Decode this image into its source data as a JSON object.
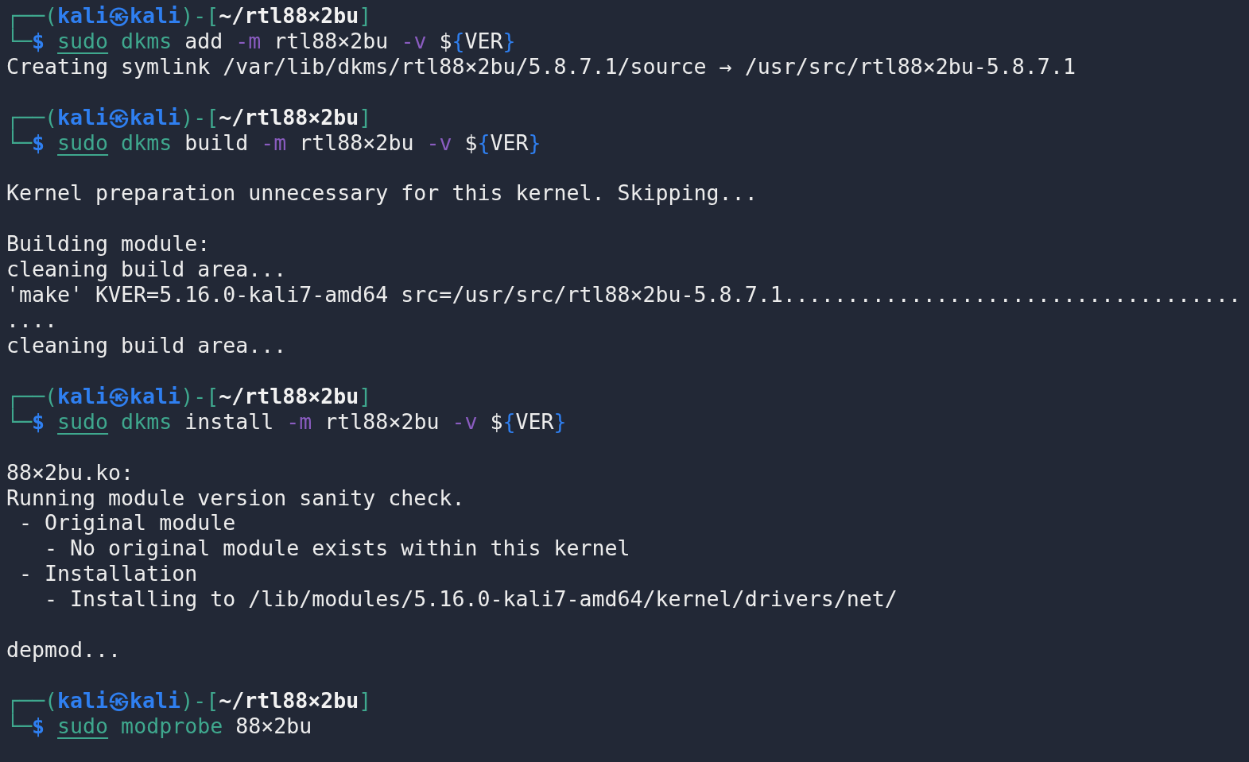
{
  "terminal": {
    "lines": [
      {
        "kind": "text",
        "segments": [
          {
            "kind": "frame",
            "text": "┌──("
          },
          {
            "kind": "user",
            "text": "kali㉿kali"
          },
          {
            "kind": "frame",
            "text": ")-["
          },
          {
            "kind": "path",
            "text": "~/rtl88×2bu"
          },
          {
            "kind": "frame",
            "text": "]"
          }
        ]
      },
      {
        "kind": "text",
        "segments": [
          {
            "kind": "frame",
            "text": "└─"
          },
          {
            "kind": "prompt",
            "text": "$ "
          },
          {
            "kind": "sudo",
            "text": "sudo"
          },
          {
            "kind": "cmd",
            "text": " dkms"
          },
          {
            "kind": "plain",
            "text": " add"
          },
          {
            "kind": "flag",
            "text": " -m"
          },
          {
            "kind": "plain",
            "text": " rtl88×2bu"
          },
          {
            "kind": "flag",
            "text": " -v"
          },
          {
            "kind": "plain",
            "text": " $"
          },
          {
            "kind": "brace",
            "text": "{"
          },
          {
            "kind": "plain",
            "text": "VER"
          },
          {
            "kind": "brace",
            "text": "}"
          }
        ]
      },
      {
        "kind": "text",
        "segments": [
          {
            "kind": "plain",
            "text": "Creating symlink /var/lib/dkms/rtl88×2bu/5.8.7.1/source → /usr/src/rtl88×2bu-5.8.7.1"
          }
        ]
      },
      {
        "kind": "gap"
      },
      {
        "kind": "text",
        "segments": [
          {
            "kind": "frame",
            "text": "┌──("
          },
          {
            "kind": "user",
            "text": "kali㉿kali"
          },
          {
            "kind": "frame",
            "text": ")-["
          },
          {
            "kind": "path",
            "text": "~/rtl88×2bu"
          },
          {
            "kind": "frame",
            "text": "]"
          }
        ]
      },
      {
        "kind": "text",
        "segments": [
          {
            "kind": "frame",
            "text": "└─"
          },
          {
            "kind": "prompt",
            "text": "$ "
          },
          {
            "kind": "sudo",
            "text": "sudo"
          },
          {
            "kind": "cmd",
            "text": " dkms"
          },
          {
            "kind": "plain",
            "text": " build"
          },
          {
            "kind": "flag",
            "text": " -m"
          },
          {
            "kind": "plain",
            "text": " rtl88×2bu"
          },
          {
            "kind": "flag",
            "text": " -v"
          },
          {
            "kind": "plain",
            "text": " $"
          },
          {
            "kind": "brace",
            "text": "{"
          },
          {
            "kind": "plain",
            "text": "VER"
          },
          {
            "kind": "brace",
            "text": "}"
          }
        ]
      },
      {
        "kind": "gap"
      },
      {
        "kind": "text",
        "segments": [
          {
            "kind": "plain",
            "text": "Kernel preparation unnecessary for this kernel. Skipping..."
          }
        ]
      },
      {
        "kind": "gap"
      },
      {
        "kind": "text",
        "segments": [
          {
            "kind": "plain",
            "text": "Building module:"
          }
        ]
      },
      {
        "kind": "text",
        "segments": [
          {
            "kind": "plain",
            "text": "cleaning build area..."
          }
        ]
      },
      {
        "kind": "text",
        "segments": [
          {
            "kind": "plain",
            "text": "'make' KVER=5.16.0-kali7-amd64 src=/usr/src/rtl88×2bu-5.8.7.1...................................."
          }
        ]
      },
      {
        "kind": "text",
        "segments": [
          {
            "kind": "plain",
            "text": "...."
          }
        ]
      },
      {
        "kind": "text",
        "segments": [
          {
            "kind": "plain",
            "text": "cleaning build area..."
          }
        ]
      },
      {
        "kind": "gap"
      },
      {
        "kind": "text",
        "segments": [
          {
            "kind": "frame",
            "text": "┌──("
          },
          {
            "kind": "user",
            "text": "kali㉿kali"
          },
          {
            "kind": "frame",
            "text": ")-["
          },
          {
            "kind": "path",
            "text": "~/rtl88×2bu"
          },
          {
            "kind": "frame",
            "text": "]"
          }
        ]
      },
      {
        "kind": "text",
        "segments": [
          {
            "kind": "frame",
            "text": "└─"
          },
          {
            "kind": "prompt",
            "text": "$ "
          },
          {
            "kind": "sudo",
            "text": "sudo"
          },
          {
            "kind": "cmd",
            "text": " dkms"
          },
          {
            "kind": "plain",
            "text": " install"
          },
          {
            "kind": "flag",
            "text": " -m"
          },
          {
            "kind": "plain",
            "text": " rtl88×2bu"
          },
          {
            "kind": "flag",
            "text": " -v"
          },
          {
            "kind": "plain",
            "text": " $"
          },
          {
            "kind": "brace",
            "text": "{"
          },
          {
            "kind": "plain",
            "text": "VER"
          },
          {
            "kind": "brace",
            "text": "}"
          }
        ]
      },
      {
        "kind": "gap"
      },
      {
        "kind": "text",
        "segments": [
          {
            "kind": "plain",
            "text": "88×2bu.ko:"
          }
        ]
      },
      {
        "kind": "text",
        "segments": [
          {
            "kind": "plain",
            "text": "Running module version sanity check."
          }
        ]
      },
      {
        "kind": "text",
        "segments": [
          {
            "kind": "plain",
            "text": " - Original module"
          }
        ]
      },
      {
        "kind": "text",
        "segments": [
          {
            "kind": "plain",
            "text": "   - No original module exists within this kernel"
          }
        ]
      },
      {
        "kind": "text",
        "segments": [
          {
            "kind": "plain",
            "text": " - Installation"
          }
        ]
      },
      {
        "kind": "text",
        "segments": [
          {
            "kind": "plain",
            "text": "   - Installing to /lib/modules/5.16.0-kali7-amd64/kernel/drivers/net/"
          }
        ]
      },
      {
        "kind": "gap"
      },
      {
        "kind": "text",
        "segments": [
          {
            "kind": "plain",
            "text": "depmod..."
          }
        ]
      },
      {
        "kind": "gap"
      },
      {
        "kind": "text",
        "segments": [
          {
            "kind": "frame",
            "text": "┌──("
          },
          {
            "kind": "user",
            "text": "kali㉿kali"
          },
          {
            "kind": "frame",
            "text": ")-["
          },
          {
            "kind": "path",
            "text": "~/rtl88×2bu"
          },
          {
            "kind": "frame",
            "text": "]"
          }
        ]
      },
      {
        "kind": "text",
        "segments": [
          {
            "kind": "frame",
            "text": "└─"
          },
          {
            "kind": "prompt",
            "text": "$ "
          },
          {
            "kind": "sudo",
            "text": "sudo"
          },
          {
            "kind": "cmd",
            "text": " modprobe"
          },
          {
            "kind": "plain",
            "text": " 88×2bu"
          }
        ]
      }
    ]
  }
}
